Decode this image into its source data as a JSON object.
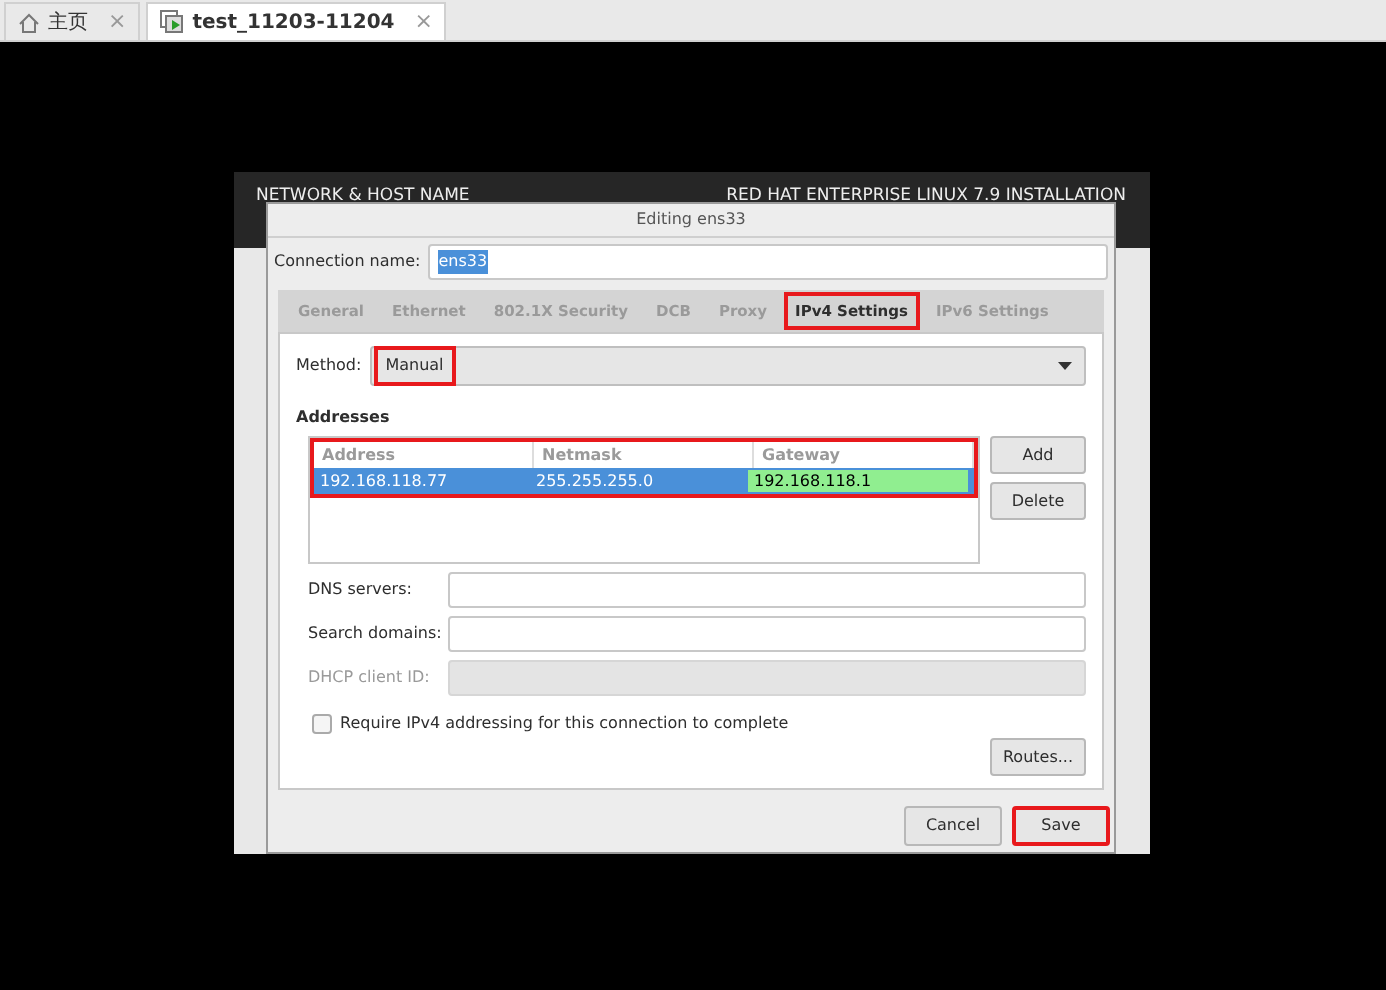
{
  "browser_tabs": [
    {
      "kind": "home",
      "label": "主页",
      "close": "×",
      "selected": false
    },
    {
      "kind": "vm",
      "label": "test_11203-11204",
      "close": "×",
      "selected": true
    }
  ],
  "installer": {
    "title": "NETWORK & HOST NAME",
    "product": "RED HAT ENTERPRISE LINUX 7.9 INSTALLATION"
  },
  "dialog": {
    "title": "Editing ens33",
    "connection_label": "Connection name:",
    "connection_name": "ens33",
    "name_selected": true,
    "tabs": [
      {
        "label": "General",
        "selected": false,
        "highlighted": false
      },
      {
        "label": "Ethernet",
        "selected": false,
        "highlighted": false
      },
      {
        "label": "802.1X Security",
        "selected": false,
        "highlighted": false
      },
      {
        "label": "DCB",
        "selected": false,
        "highlighted": false
      },
      {
        "label": "Proxy",
        "selected": false,
        "highlighted": false
      },
      {
        "label": "IPv4 Settings",
        "selected": true,
        "highlighted": true
      },
      {
        "label": "IPv6 Settings",
        "selected": false,
        "highlighted": false
      }
    ],
    "method": {
      "label": "Method:",
      "value": "Manual",
      "highlighted": true
    },
    "addresses": {
      "title": "Addresses",
      "highlighted": true,
      "columns": [
        "Address",
        "Netmask",
        "Gateway"
      ],
      "rows": [
        {
          "selected": true,
          "cells": [
            {
              "text": "192.168.118.77",
              "editing": false
            },
            {
              "text": "255.255.255.0",
              "editing": false
            },
            {
              "text": "192.168.118.1",
              "editing": true
            }
          ]
        }
      ],
      "buttons": [
        "Add",
        "Delete"
      ]
    },
    "fields": [
      {
        "label": "DNS servers:",
        "disabled": false
      },
      {
        "label": "Search domains:",
        "disabled": false
      },
      {
        "label": "DHCP client ID:",
        "disabled": true
      }
    ],
    "require_checkbox": {
      "label": "Require IPv4 addressing for this connection to complete",
      "checked": false
    },
    "routes_button": "Routes...",
    "footer_buttons": [
      {
        "label": "Cancel",
        "highlighted": false
      },
      {
        "label": "Save",
        "highlighted": true
      }
    ]
  }
}
